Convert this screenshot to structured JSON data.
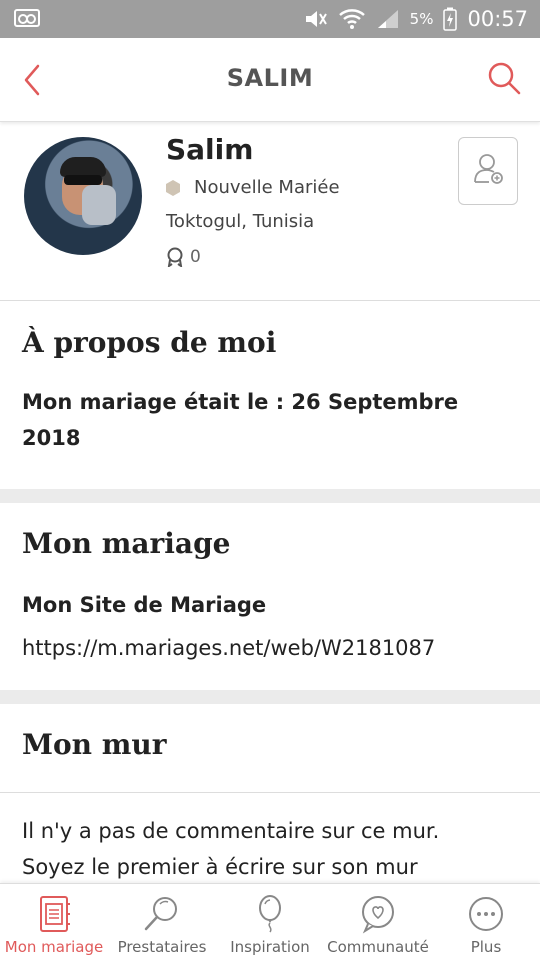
{
  "status_bar": {
    "battery_percent": "5%",
    "time": "00:57",
    "icons": [
      "voicemail-icon",
      "mute-icon",
      "wifi-icon",
      "signal-icon",
      "battery-charging-icon"
    ]
  },
  "header": {
    "title": "SALIM",
    "back_icon": "chevron-left-icon",
    "search_icon": "search-icon"
  },
  "profile": {
    "name": "Salim",
    "role": "Nouvelle Mariée",
    "location": "Toktogul, Tunisia",
    "medals_count": "0",
    "follow_icon": "add-user-icon"
  },
  "about": {
    "title": "À propos de moi",
    "wedding_date_text": "Mon mariage était le : 26 Septembre 2018"
  },
  "wedding": {
    "title": "Mon mariage",
    "site_label": "Mon Site de Mariage",
    "site_url": "https://m.mariages.net/web/W2181087"
  },
  "wall": {
    "title": "Mon mur",
    "empty_message": "Il n'y a pas de commentaire sur ce mur. Soyez le premier à écrire sur son mur"
  },
  "bottom_nav": {
    "items": [
      {
        "label": "Mon mariage",
        "icon": "planner-icon",
        "active": true
      },
      {
        "label": "Prestataires",
        "icon": "magnifier-icon",
        "active": false
      },
      {
        "label": "Inspiration",
        "icon": "balloon-icon",
        "active": false
      },
      {
        "label": "Communauté",
        "icon": "heart-bubble-icon",
        "active": false
      },
      {
        "label": "Plus",
        "icon": "more-icon",
        "active": false
      }
    ]
  },
  "colors": {
    "accent": "#e05a5a",
    "status_bar": "#9e9e9e",
    "section_gap": "#ebebeb"
  }
}
